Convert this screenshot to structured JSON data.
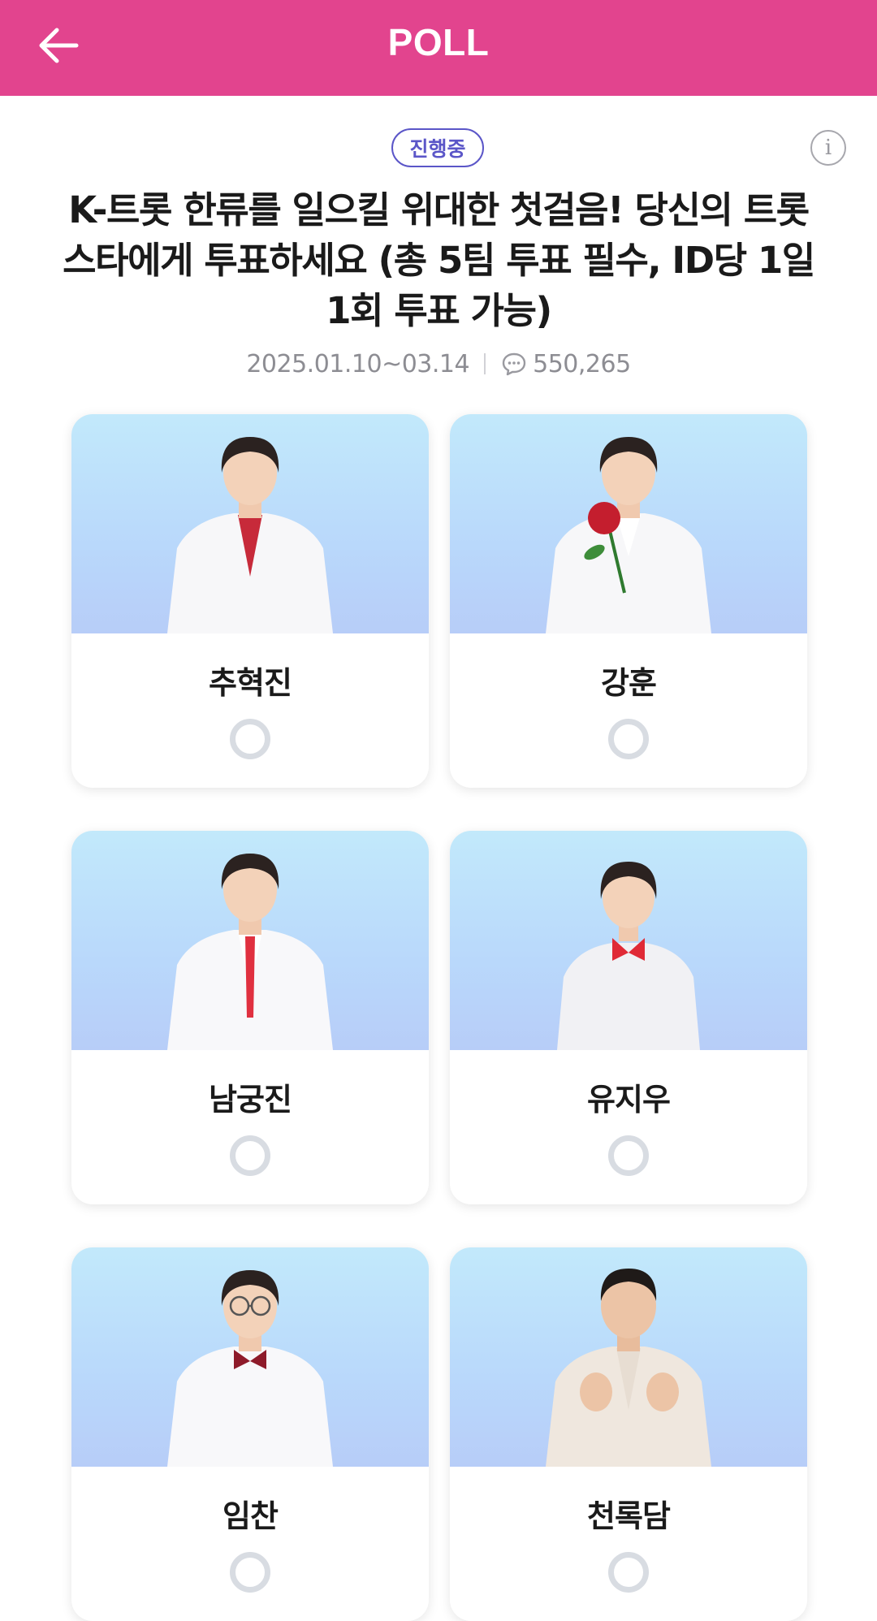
{
  "header": {
    "title": "POLL",
    "back_icon": "arrow-left-icon",
    "background": "#e2448e"
  },
  "poll": {
    "status": "진행중",
    "info_icon": "info-icon",
    "title": "K-트롯 한류를 일으킬 위대한 첫걸음! 당신의 트롯 스타에게 투표하세요 (총 5팀 투표 필수, ID당 1일 1회 투표 가능)",
    "period": "2025.01.10~03.14",
    "comment_icon": "comment-icon",
    "comment_count": "550,265"
  },
  "candidates": [
    {
      "name": "추혁진",
      "suit": "#f7f7f9",
      "accent": "#c72a3a",
      "hair": "#2b2220"
    },
    {
      "name": "강훈",
      "suit": "#f7f7f9",
      "accent": "#c41e2e",
      "hair": "#2b2220"
    },
    {
      "name": "남궁진",
      "suit": "#f8f8fa",
      "accent": "#e0303f",
      "hair": "#2b2220"
    },
    {
      "name": "유지우",
      "suit": "#f1f1f4",
      "accent": "#e02a36",
      "hair": "#2b2220"
    },
    {
      "name": "임찬",
      "suit": "#f8f8fa",
      "accent": "#8e1b2a",
      "hair": "#2b2220"
    },
    {
      "name": "천록담",
      "suit": "#efe7de",
      "accent": "#e7ddd2",
      "hair": "#1f1a18"
    }
  ]
}
